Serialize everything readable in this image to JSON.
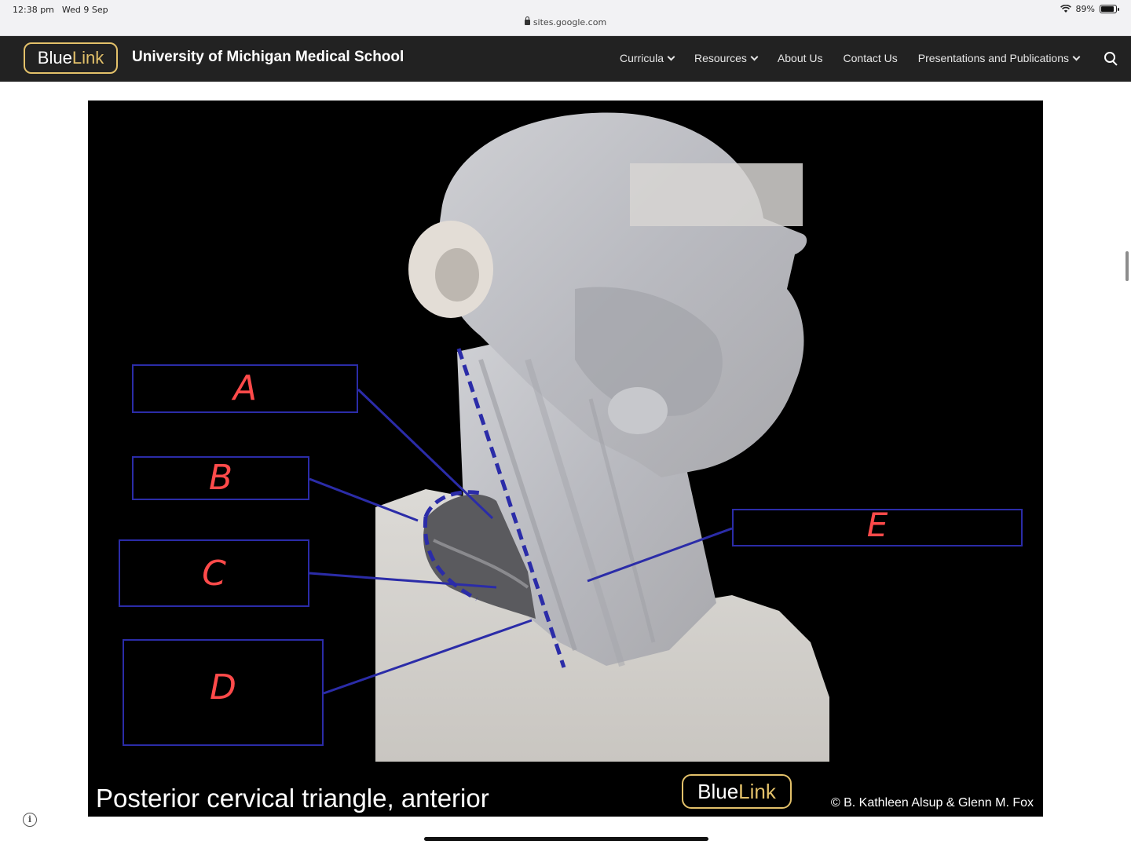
{
  "status_bar": {
    "time": "12:38 pm",
    "date": "Wed 9 Sep",
    "battery_text": "89%",
    "battery_level": 0.89,
    "url": "sites.google.com"
  },
  "navbar": {
    "logo_blue": "Blue",
    "logo_link": "Link",
    "site_title": "University of Michigan Medical School",
    "items": [
      {
        "label": "Curricula",
        "dropdown": true
      },
      {
        "label": "Resources",
        "dropdown": true
      },
      {
        "label": "About Us",
        "dropdown": false
      },
      {
        "label": "Contact Us",
        "dropdown": false
      },
      {
        "label": "Presentations and Publications",
        "dropdown": true
      }
    ]
  },
  "figure": {
    "caption": "Posterior cervical triangle, anterior",
    "brand_blue": "Blue",
    "brand_link": "Link",
    "credit": "© B. Kathleen Alsup & Glenn M. Fox",
    "labels": [
      "A",
      "B",
      "C",
      "D",
      "E"
    ]
  },
  "colors": {
    "navbar_bg": "#222222",
    "brand_gold": "#e3c16a",
    "label_blue": "#2b2ca8",
    "label_red": "#ff4a4a"
  }
}
